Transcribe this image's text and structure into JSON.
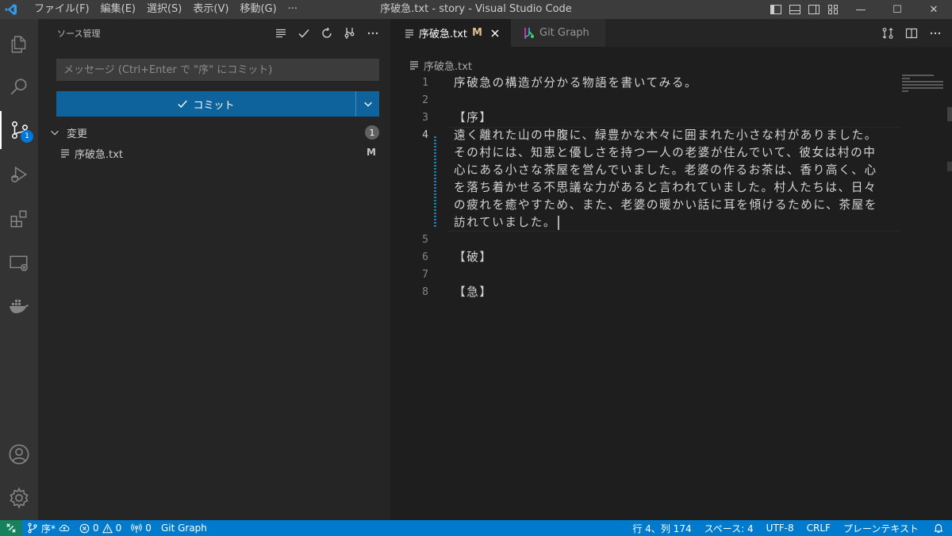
{
  "window": {
    "title": "序破急.txt - story - Visual Studio Code",
    "menu": [
      "ファイル(F)",
      "編集(E)",
      "選択(S)",
      "表示(V)",
      "移動(G)",
      "···"
    ],
    "controls": {
      "minimize": "—",
      "maximize": "☐",
      "close": "✕"
    }
  },
  "activity_bar": {
    "items": [
      "explorer-icon",
      "search-icon",
      "source-control-icon",
      "run-debug-icon",
      "extensions-icon",
      "remote-explorer-icon",
      "docker-icon"
    ],
    "source_control_badge": "1",
    "bottom": [
      "account-icon",
      "manage-gear-icon"
    ]
  },
  "sidebar": {
    "title": "ソース管理",
    "commit_message_placeholder": "メッセージ (Ctrl+Enter で \"序\" にコミット)",
    "commit_button_label": "コミット",
    "changes_label": "変更",
    "changes_count": "1",
    "files": [
      {
        "name": "序破急.txt",
        "status": "M"
      }
    ]
  },
  "editor": {
    "tabs": [
      {
        "label": "序破急.txt",
        "modified": "M",
        "active": true
      },
      {
        "label": "Git Graph",
        "active": false
      }
    ],
    "breadcrumb": "序破急.txt",
    "line_numbers": [
      "1",
      "2",
      "3",
      "4",
      "5",
      "6",
      "7",
      "8"
    ],
    "lines": [
      "序破急の構造が分かる物語を書いてみる。",
      "",
      "【序】",
      "遠く離れた山の中腹に、緑豊かな木々に囲まれた小さな村がありました。",
      "その村には、知恵と優しさを持つ一人の老婆が住んでいて、彼女は村の中",
      "心にある小さな茶屋を営んでいました。老婆の作るお茶は、香り高く、心",
      "を落ち着かせる不思議な力があると言われていました。村人たちは、日々",
      "の疲れを癒やすため、また、老婆の暖かい話に耳を傾けるために、茶屋を",
      "訪れていました。",
      "",
      "【破】",
      "",
      "【急】"
    ]
  },
  "status_bar": {
    "branch": "序*",
    "errors": "0",
    "warnings": "0",
    "ports": "0",
    "git_graph": "Git Graph",
    "position": "行 4、列 174",
    "spaces": "スペース: 4",
    "encoding": "UTF-8",
    "eol": "CRLF",
    "language": "プレーンテキスト"
  },
  "colors": {
    "accent": "#007acc",
    "commit_button": "#0e639c",
    "modified": "#e2c08d",
    "remote": "#16825d"
  }
}
